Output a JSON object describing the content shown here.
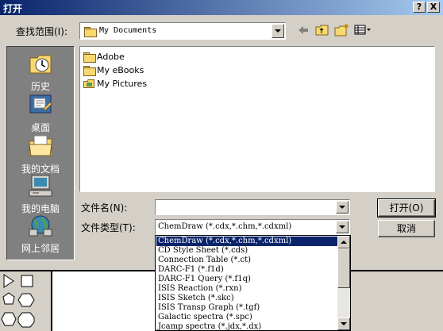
{
  "dialog": {
    "title": "打开",
    "help_glyph": "?",
    "close_glyph": "X"
  },
  "lookin": {
    "label": "查找范围(I):",
    "value": "My Documents"
  },
  "places": [
    {
      "label": "历史",
      "icon": "history-icon"
    },
    {
      "label": "桌面",
      "icon": "desktop-icon"
    },
    {
      "label": "我的文档",
      "icon": "my-documents-icon"
    },
    {
      "label": "我的电脑",
      "icon": "my-computer-icon"
    },
    {
      "label": "网上邻居",
      "icon": "network-places-icon"
    }
  ],
  "files": [
    {
      "name": "Adobe",
      "icon": "folder-icon"
    },
    {
      "name": "My eBooks",
      "icon": "folder-icon"
    },
    {
      "name": "My Pictures",
      "icon": "pictures-folder-icon"
    }
  ],
  "filename": {
    "label": "文件名(N):",
    "value": ""
  },
  "filetype": {
    "label": "文件类型(T):",
    "value": "ChemDraw (*.cdx,*.chm,*.cdxml)",
    "options": [
      "ChemDraw (*.cdx,*.chm,*.cdxml)",
      "CD Style Sheet (*.cds)",
      "Connection Table (*.ct)",
      "DARC-F1 (*.f1d)",
      "DARC-F1 Query (*.f1q)",
      "ISIS Reaction (*.rxn)",
      "ISIS Sketch (*.skc)",
      "ISIS Transp Graph (*.tgf)",
      "Galactic spectra (*.spc)",
      "Jcamp spectra (*.jdx,*.dx)"
    ],
    "selected_index": 0
  },
  "buttons": {
    "open": "打开(O)",
    "cancel": "取消"
  },
  "colors": {
    "title_bar": "#0a246a",
    "selection": "#0a246a",
    "face": "#d4d0c8",
    "places_bar": "#808080"
  }
}
